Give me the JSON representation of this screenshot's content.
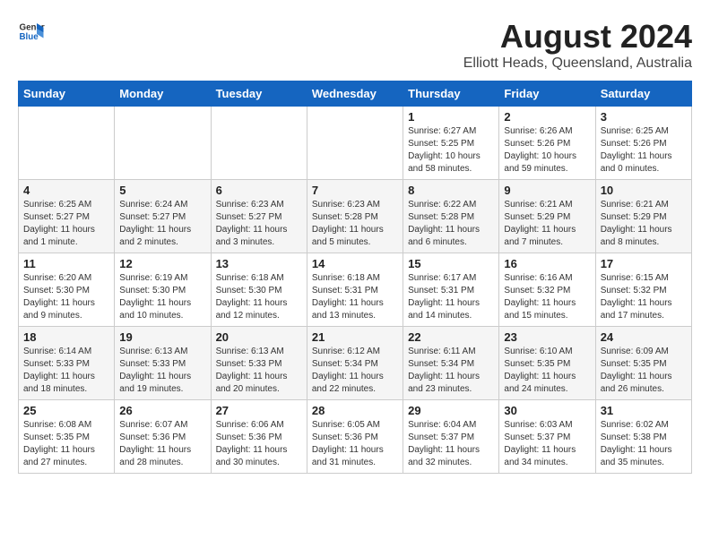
{
  "header": {
    "logo_general": "General",
    "logo_blue": "Blue",
    "title": "August 2024",
    "subtitle": "Elliott Heads, Queensland, Australia"
  },
  "days_of_week": [
    "Sunday",
    "Monday",
    "Tuesday",
    "Wednesday",
    "Thursday",
    "Friday",
    "Saturday"
  ],
  "weeks": [
    [
      {
        "day": "",
        "info": ""
      },
      {
        "day": "",
        "info": ""
      },
      {
        "day": "",
        "info": ""
      },
      {
        "day": "",
        "info": ""
      },
      {
        "day": "1",
        "info": "Sunrise: 6:27 AM\nSunset: 5:25 PM\nDaylight: 10 hours\nand 58 minutes."
      },
      {
        "day": "2",
        "info": "Sunrise: 6:26 AM\nSunset: 5:26 PM\nDaylight: 10 hours\nand 59 minutes."
      },
      {
        "day": "3",
        "info": "Sunrise: 6:25 AM\nSunset: 5:26 PM\nDaylight: 11 hours\nand 0 minutes."
      }
    ],
    [
      {
        "day": "4",
        "info": "Sunrise: 6:25 AM\nSunset: 5:27 PM\nDaylight: 11 hours\nand 1 minute."
      },
      {
        "day": "5",
        "info": "Sunrise: 6:24 AM\nSunset: 5:27 PM\nDaylight: 11 hours\nand 2 minutes."
      },
      {
        "day": "6",
        "info": "Sunrise: 6:23 AM\nSunset: 5:27 PM\nDaylight: 11 hours\nand 3 minutes."
      },
      {
        "day": "7",
        "info": "Sunrise: 6:23 AM\nSunset: 5:28 PM\nDaylight: 11 hours\nand 5 minutes."
      },
      {
        "day": "8",
        "info": "Sunrise: 6:22 AM\nSunset: 5:28 PM\nDaylight: 11 hours\nand 6 minutes."
      },
      {
        "day": "9",
        "info": "Sunrise: 6:21 AM\nSunset: 5:29 PM\nDaylight: 11 hours\nand 7 minutes."
      },
      {
        "day": "10",
        "info": "Sunrise: 6:21 AM\nSunset: 5:29 PM\nDaylight: 11 hours\nand 8 minutes."
      }
    ],
    [
      {
        "day": "11",
        "info": "Sunrise: 6:20 AM\nSunset: 5:30 PM\nDaylight: 11 hours\nand 9 minutes."
      },
      {
        "day": "12",
        "info": "Sunrise: 6:19 AM\nSunset: 5:30 PM\nDaylight: 11 hours\nand 10 minutes."
      },
      {
        "day": "13",
        "info": "Sunrise: 6:18 AM\nSunset: 5:30 PM\nDaylight: 11 hours\nand 12 minutes."
      },
      {
        "day": "14",
        "info": "Sunrise: 6:18 AM\nSunset: 5:31 PM\nDaylight: 11 hours\nand 13 minutes."
      },
      {
        "day": "15",
        "info": "Sunrise: 6:17 AM\nSunset: 5:31 PM\nDaylight: 11 hours\nand 14 minutes."
      },
      {
        "day": "16",
        "info": "Sunrise: 6:16 AM\nSunset: 5:32 PM\nDaylight: 11 hours\nand 15 minutes."
      },
      {
        "day": "17",
        "info": "Sunrise: 6:15 AM\nSunset: 5:32 PM\nDaylight: 11 hours\nand 17 minutes."
      }
    ],
    [
      {
        "day": "18",
        "info": "Sunrise: 6:14 AM\nSunset: 5:33 PM\nDaylight: 11 hours\nand 18 minutes."
      },
      {
        "day": "19",
        "info": "Sunrise: 6:13 AM\nSunset: 5:33 PM\nDaylight: 11 hours\nand 19 minutes."
      },
      {
        "day": "20",
        "info": "Sunrise: 6:13 AM\nSunset: 5:33 PM\nDaylight: 11 hours\nand 20 minutes."
      },
      {
        "day": "21",
        "info": "Sunrise: 6:12 AM\nSunset: 5:34 PM\nDaylight: 11 hours\nand 22 minutes."
      },
      {
        "day": "22",
        "info": "Sunrise: 6:11 AM\nSunset: 5:34 PM\nDaylight: 11 hours\nand 23 minutes."
      },
      {
        "day": "23",
        "info": "Sunrise: 6:10 AM\nSunset: 5:35 PM\nDaylight: 11 hours\nand 24 minutes."
      },
      {
        "day": "24",
        "info": "Sunrise: 6:09 AM\nSunset: 5:35 PM\nDaylight: 11 hours\nand 26 minutes."
      }
    ],
    [
      {
        "day": "25",
        "info": "Sunrise: 6:08 AM\nSunset: 5:35 PM\nDaylight: 11 hours\nand 27 minutes."
      },
      {
        "day": "26",
        "info": "Sunrise: 6:07 AM\nSunset: 5:36 PM\nDaylight: 11 hours\nand 28 minutes."
      },
      {
        "day": "27",
        "info": "Sunrise: 6:06 AM\nSunset: 5:36 PM\nDaylight: 11 hours\nand 30 minutes."
      },
      {
        "day": "28",
        "info": "Sunrise: 6:05 AM\nSunset: 5:36 PM\nDaylight: 11 hours\nand 31 minutes."
      },
      {
        "day": "29",
        "info": "Sunrise: 6:04 AM\nSunset: 5:37 PM\nDaylight: 11 hours\nand 32 minutes."
      },
      {
        "day": "30",
        "info": "Sunrise: 6:03 AM\nSunset: 5:37 PM\nDaylight: 11 hours\nand 34 minutes."
      },
      {
        "day": "31",
        "info": "Sunrise: 6:02 AM\nSunset: 5:38 PM\nDaylight: 11 hours\nand 35 minutes."
      }
    ]
  ]
}
